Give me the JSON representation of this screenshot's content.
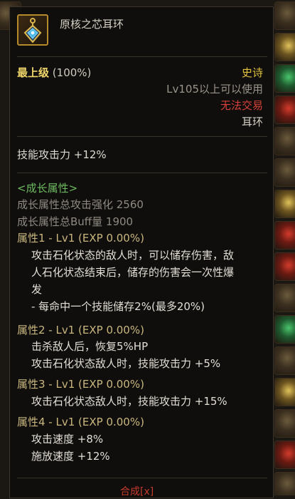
{
  "item": {
    "name": "原核之芯耳环",
    "grade": "最上级",
    "grade_pct": "(100%)",
    "rarity": "史诗",
    "level_req": "Lv105以上可以使用",
    "trade": "无法交易",
    "slot": "耳环"
  },
  "stats": {
    "skill_attack": "技能攻击力   +12%"
  },
  "growth": {
    "title": "<成长属性>",
    "total_attack": "成长属性总攻击强化 2560",
    "total_buff": "成长属性总Buff量 1900",
    "attributes": [
      {
        "title": "属性1 - Lv1 (EXP 0.00%)",
        "lines": [
          "攻击石化状态的敌人时，可以储存伤害，敌",
          "人石化状态结束后，储存的伤害会一次性爆",
          "发",
          "- 每命中一个技能储存2%(最多20%)"
        ]
      },
      {
        "title": "属性2 - Lv1 (EXP 0.00%)",
        "lines": [
          "击杀敌人后，恢复5%HP",
          "攻击石化状态敌人时，技能攻击力 +5%"
        ]
      },
      {
        "title": "属性3 - Lv1 (EXP 0.00%)",
        "lines": [
          "攻击石化状态敌人时，技能攻击力 +15%"
        ]
      },
      {
        "title": "属性4 - Lv1 (EXP 0.00%)",
        "lines": [
          "攻击速度 +8%",
          "施放速度 +12%"
        ]
      }
    ]
  },
  "footer": {
    "synth": "合成[x]"
  },
  "colors": {
    "rarity": "#e3c23e",
    "trade": "#d9413a",
    "growth_title": "#6dbb5f",
    "attr_title": "#c9b77e"
  },
  "icons": {
    "item": "earring-icon"
  }
}
